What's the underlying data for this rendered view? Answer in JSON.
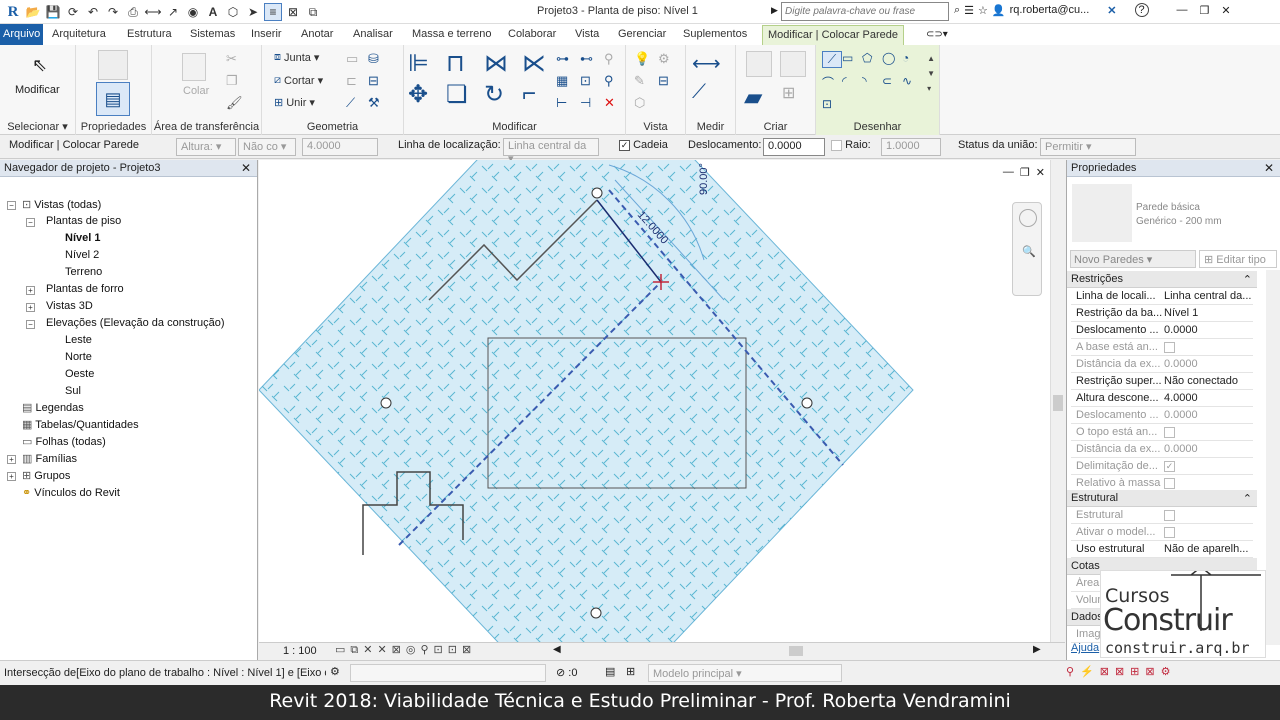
{
  "app": {
    "logo": "R",
    "title": "Projeto3 - Planta de piso: Nível 1",
    "search_placeholder": "Digite palavra-chave ou frase",
    "user": "rq.roberta@cu...",
    "help": "?"
  },
  "tabs": [
    "Arquivo",
    "Arquitetura",
    "Estrutura",
    "Sistemas",
    "Inserir",
    "Anotar",
    "Analisar",
    "Massa e terreno",
    "Colaborar",
    "Vista",
    "Gerenciar",
    "Suplementos",
    "Modificar | Colocar Parede"
  ],
  "ribbon": {
    "modify": "Modificar",
    "paste": "Colar",
    "join": "Junta",
    "cut": "Cortar",
    "unite": "Unir",
    "panels": [
      "Selecionar",
      "Propriedades",
      "Área de transferência",
      "Geometria",
      "Modificar",
      "Vista",
      "Medir",
      "Criar",
      "Desenhar"
    ]
  },
  "options": {
    "context": "Modificar | Colocar Parede",
    "height_label": "Altura:",
    "height_value": "Não co",
    "height_num": "4.0000",
    "loc_label": "Linha de localização:",
    "loc_value": "Linha central da",
    "chain_label": "Cadeia",
    "offset_label": "Deslocamento:",
    "offset_value": "0.0000",
    "radius_label": "Raio:",
    "radius_value": "1.0000",
    "join_label": "Status da união:",
    "join_value": "Permitir"
  },
  "navigator": {
    "title": "Navegador de projeto - Projeto3",
    "items": [
      "Vistas (todas)",
      "Plantas de piso",
      "Nível 1",
      "Nível 2",
      "Terreno",
      "Plantas de forro",
      "Vistas 3D",
      "Elevações (Elevação da construção)",
      "Leste",
      "Norte",
      "Oeste",
      "Sul",
      "Legendas",
      "Tabelas/Quantidades",
      "Folhas (todas)",
      "Famílias",
      "Grupos",
      "Vínculos do Revit"
    ]
  },
  "canvas": {
    "dim_length": "12.0000",
    "dim_angle": "90.00°",
    "scale": "1 : 100"
  },
  "properties": {
    "title": "Propriedades",
    "type_name": "Parede básica",
    "type_sub": "Genérico - 200 mm",
    "instance_select": "Novo Paredes",
    "edit_type": "Editar tipo",
    "sections": [
      "Restrições",
      "Estrutural",
      "Cotas",
      "Dados"
    ],
    "rows_restricoes": [
      {
        "k": "Linha de locali...",
        "v": "Linha central da..."
      },
      {
        "k": "Restrição da ba...",
        "v": "Nível 1"
      },
      {
        "k": "Deslocamento ...",
        "v": "0.0000"
      },
      {
        "k": "A base está an...",
        "v": ""
      },
      {
        "k": "Distância da ex...",
        "v": "0.0000"
      },
      {
        "k": "Restrição super...",
        "v": "Não conectado"
      },
      {
        "k": "Altura descone...",
        "v": "4.0000"
      },
      {
        "k": "Deslocamento ...",
        "v": "0.0000"
      },
      {
        "k": "O topo está an...",
        "v": ""
      },
      {
        "k": "Distância da ex...",
        "v": "0.0000"
      },
      {
        "k": "Delimitação de...",
        "v": "✓"
      },
      {
        "k": "Relativo à massa",
        "v": ""
      }
    ],
    "rows_estrutural": [
      {
        "k": "Estrutural",
        "v": ""
      },
      {
        "k": "Ativar o model...",
        "v": ""
      },
      {
        "k": "Uso estrutural",
        "v": "Não de aparelh..."
      }
    ],
    "cotas_rows": [
      "Área",
      "Volum"
    ],
    "dados_row": "Image",
    "help_link": "Ajuda"
  },
  "status": {
    "message": "Intersecção de[Eixo do plano de trabalho : Nível : Nível 1] e [Eixo c",
    "zero": ":0",
    "model": "Modelo principal"
  },
  "logo": {
    "line1": "Cursos",
    "line2": "Construir",
    "line3": "construir.arq.br"
  },
  "banner": "Revit 2018: Viabilidade Técnica e Estudo Preliminar - Prof. Roberta Vendramini"
}
